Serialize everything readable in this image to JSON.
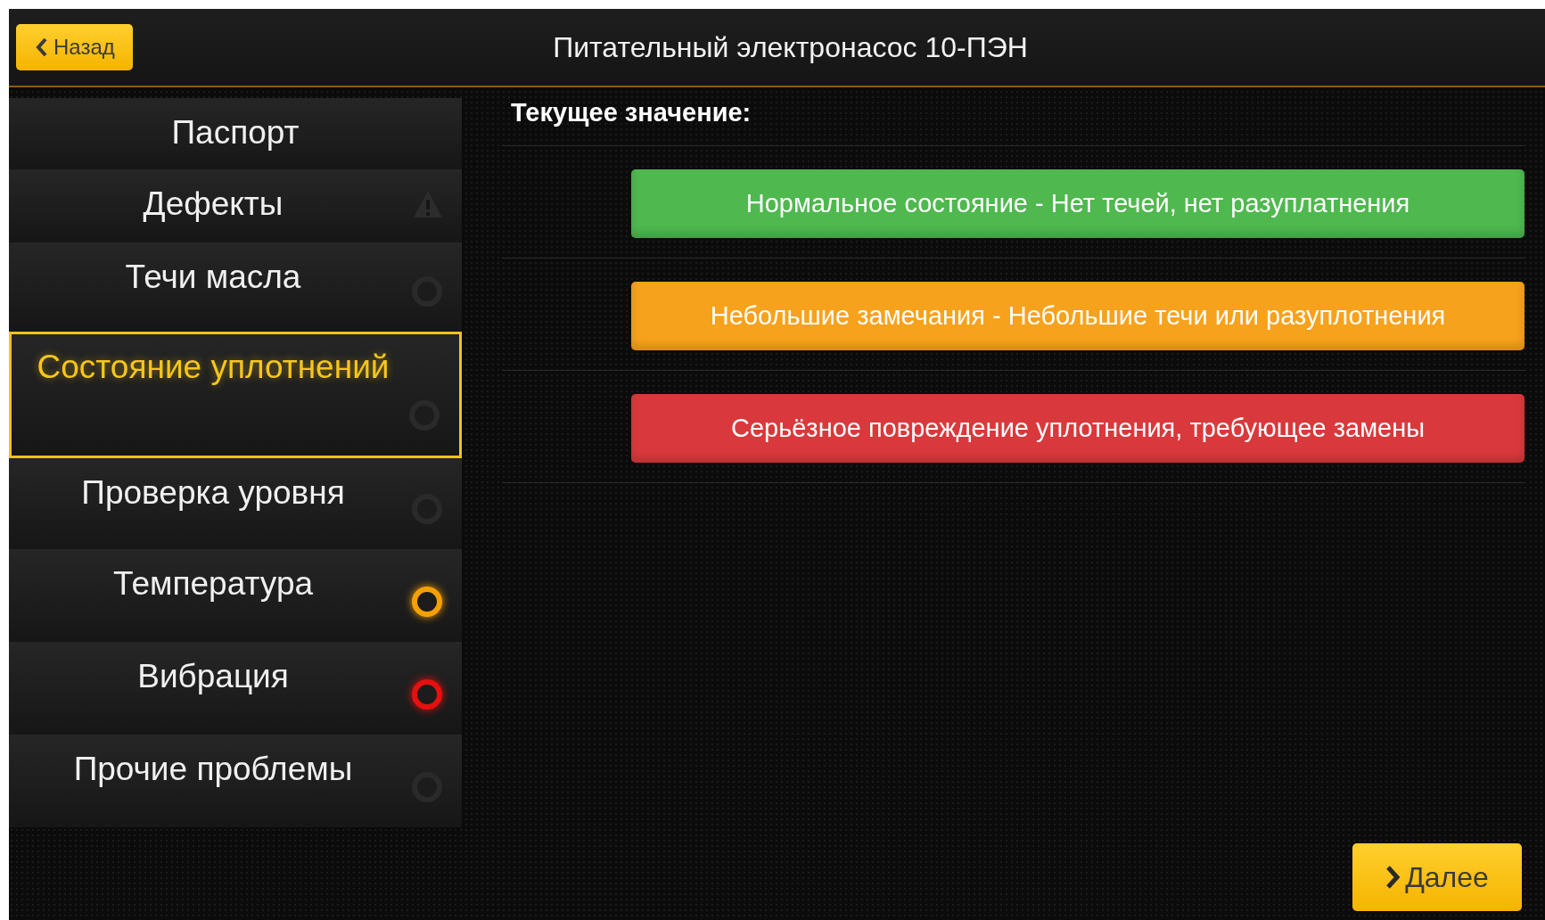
{
  "header": {
    "back_button": "Назад",
    "title": "Питательный электронасос 10-ПЭН"
  },
  "sidebar": {
    "items": [
      {
        "label": "Паспорт",
        "kind": "plain",
        "selected": false
      },
      {
        "label": "Дефекты",
        "kind": "warning",
        "selected": false
      },
      {
        "label": "Течи масла",
        "kind": "status",
        "color": "#2a2a2a",
        "selected": false
      },
      {
        "label": "Состояние уплотнений",
        "kind": "status",
        "color": "#2a2a2a",
        "selected": true
      },
      {
        "label": "Проверка уровня",
        "kind": "status",
        "color": "#2a2a2a",
        "selected": false
      },
      {
        "label": "Температура",
        "kind": "status",
        "color": "#f5a000",
        "selected": false
      },
      {
        "label": "Вибрация",
        "kind": "status",
        "color": "#e51010",
        "selected": false
      },
      {
        "label": "Прочие проблемы",
        "kind": "status",
        "color": "#2a2a2a",
        "selected": false
      }
    ]
  },
  "main": {
    "heading": "Текущее значение:",
    "options": [
      {
        "label": "Нормальное состояние - Нет течей, нет разуплатнения",
        "color": "#4fb84f"
      },
      {
        "label": "Небольшие замечания - Небольшие течи или разуплотнения",
        "color": "#f7a21c"
      },
      {
        "label": "Серьёзное повреждение уплотнения, требующее замены",
        "color": "#d9393c"
      }
    ]
  },
  "next_button": "Далее"
}
